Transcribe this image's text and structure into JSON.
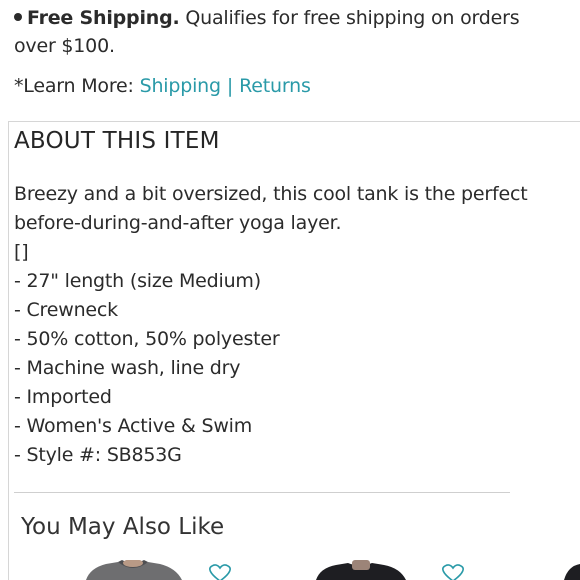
{
  "shipping": {
    "title": "Free Shipping.",
    "text": "Qualifies for free shipping on orders over $100."
  },
  "learn_more": {
    "label": "*Learn More:",
    "links": [
      "Shipping",
      "Returns"
    ],
    "separator": "|"
  },
  "about": {
    "title": "ABOUT THIS ITEM",
    "description": "Breezy and a bit oversized, this cool tank is the perfect before-during-and-after yoga layer.",
    "placeholder_glyph": "[]",
    "details": [
      "- 27\" length (size Medium)",
      "- Crewneck",
      "- 50% cotton, 50% polyester",
      "- Machine wash, line dry",
      "- Imported",
      "- Women's Active & Swim",
      "- Style #: SB853G"
    ]
  },
  "recommendations": {
    "title": "You May Also Like",
    "items": [
      {
        "icon": "heart-icon"
      },
      {
        "icon": "heart-icon"
      }
    ]
  },
  "colors": {
    "link": "#2a9aa8",
    "text": "#2b2b2b",
    "heart": "#2a9aa8"
  }
}
